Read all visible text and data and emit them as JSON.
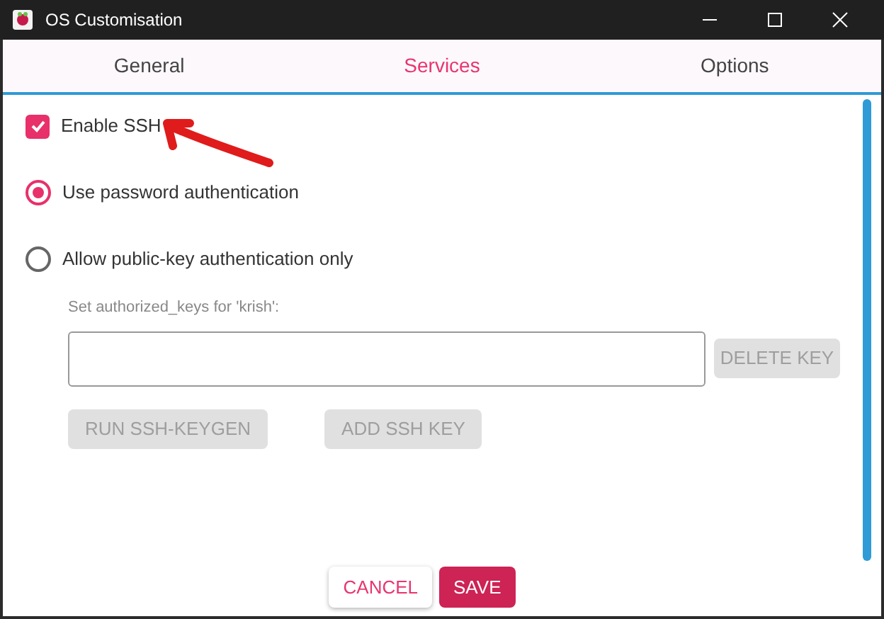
{
  "window": {
    "title": "OS Customisation"
  },
  "tabs": [
    {
      "label": "General",
      "selected": false
    },
    {
      "label": "Services",
      "selected": true
    },
    {
      "label": "Options",
      "selected": false
    }
  ],
  "enable_ssh": {
    "label": "Enable SSH",
    "checked": true
  },
  "auth_options": [
    {
      "label": "Use password authentication",
      "selected": true
    },
    {
      "label": "Allow public-key authentication only",
      "selected": false
    }
  ],
  "authorized_keys": {
    "label": "Set authorized_keys for 'krish':",
    "delete_button": {
      "label": "DELETE KEY",
      "disabled": true
    }
  },
  "key_buttons": [
    {
      "label": "RUN SSH-KEYGEN",
      "disabled": true
    },
    {
      "label": "ADD SSH KEY",
      "disabled": true
    }
  ],
  "footer_buttons": [
    {
      "label": "CANCEL",
      "kind": "secondary"
    },
    {
      "label": "SAVE",
      "kind": "primary"
    }
  ]
}
